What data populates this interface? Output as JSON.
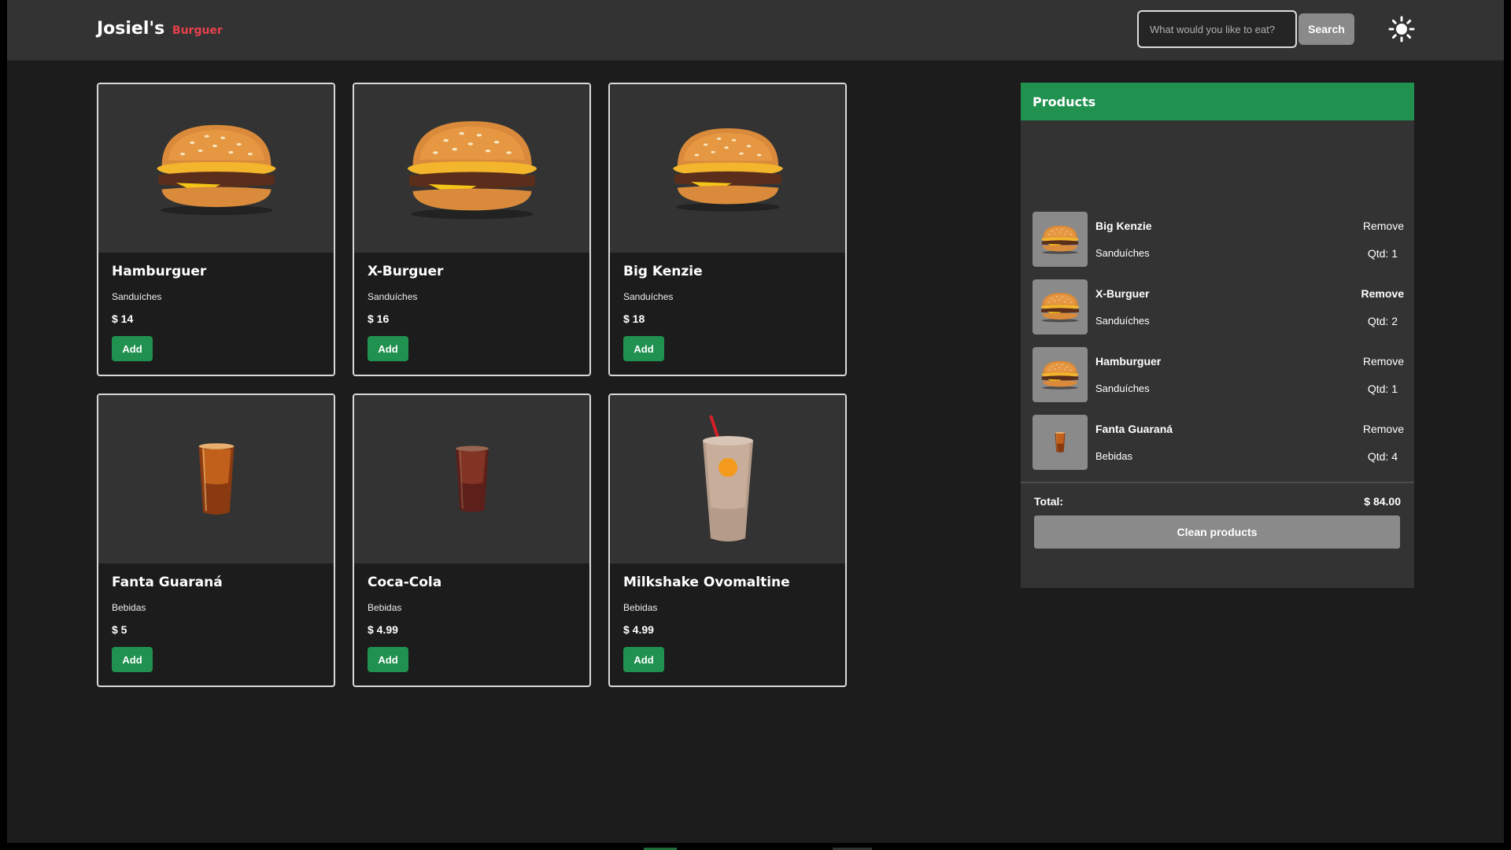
{
  "header": {
    "brand": "Josiel's",
    "brand_sub": "Burguer",
    "search_placeholder": "What would you like to eat?",
    "search_button": "Search",
    "theme_icon": "sun-icon"
  },
  "products": [
    {
      "name": "Hamburguer",
      "category": "Sanduíches",
      "price": "$ 14",
      "add": "Add",
      "icon": "burger-icon"
    },
    {
      "name": "X-Burguer",
      "category": "Sanduíches",
      "price": "$ 16",
      "add": "Add",
      "icon": "burger-icon"
    },
    {
      "name": "Big Kenzie",
      "category": "Sanduíches",
      "price": "$ 18",
      "add": "Add",
      "icon": "burger-icon"
    },
    {
      "name": "Fanta Guaraná",
      "category": "Bebidas",
      "price": "$ 5",
      "add": "Add",
      "icon": "soda-glass-icon"
    },
    {
      "name": "Coca-Cola",
      "category": "Bebidas",
      "price": "$ 4.99",
      "add": "Add",
      "icon": "soda-glass-icon"
    },
    {
      "name": "Milkshake Ovomaltine",
      "category": "Bebidas",
      "price": "$ 4.99",
      "add": "Add",
      "icon": "milkshake-icon"
    }
  ],
  "cart": {
    "title": "Products",
    "items": [
      {
        "name": "Big Kenzie",
        "category": "Sanduíches",
        "remove": "Remove",
        "qty": "Qtd: 1"
      },
      {
        "name": "X-Burguer",
        "category": "Sanduíches",
        "remove": "Remove",
        "qty": "Qtd: 2"
      },
      {
        "name": "Hamburguer",
        "category": "Sanduíches",
        "remove": "Remove",
        "qty": "Qtd: 1"
      },
      {
        "name": "Fanta Guaraná",
        "category": "Bebidas",
        "remove": "Remove",
        "qty": "Qtd: 4"
      }
    ],
    "total_label": "Total:",
    "total_value": "$ 84.00",
    "clean_button": "Clean products"
  },
  "colors": {
    "accent_green": "#219150",
    "brand_red": "#e8414c",
    "header_bg": "#333333",
    "page_bg": "#1c1c1c"
  }
}
